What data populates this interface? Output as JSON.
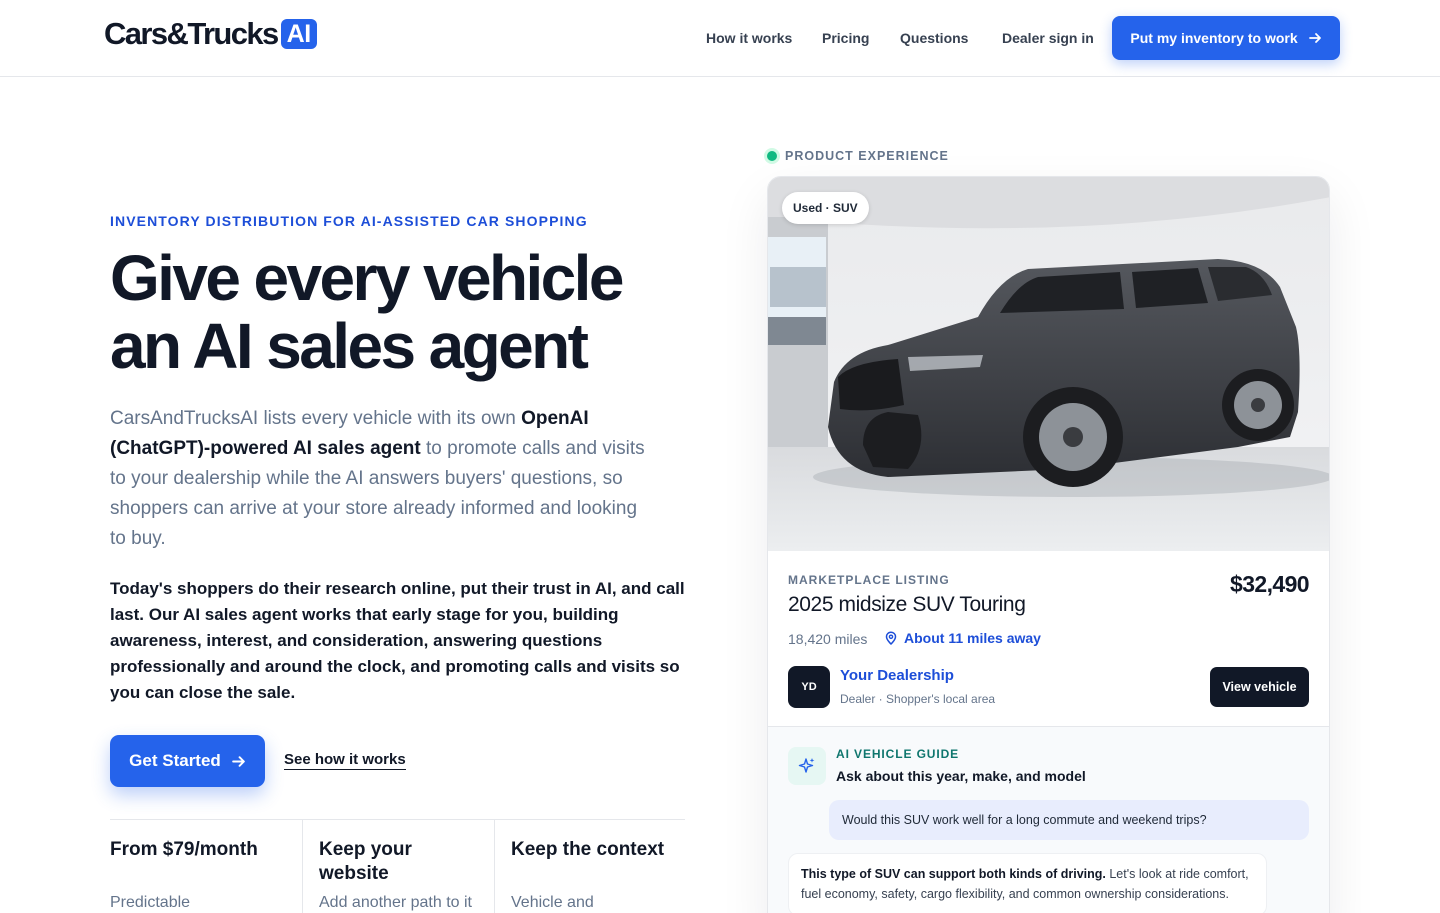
{
  "header": {
    "logo_text": "Cars&Trucks",
    "logo_badge": "AI",
    "nav": [
      "How it works",
      "Pricing",
      "Questions",
      "Dealer sign in"
    ],
    "cta_label": "Put my inventory to work",
    "brand_color": "#2563eb"
  },
  "hero": {
    "eyebrow": "INVENTORY DISTRIBUTION FOR AI-ASSISTED CAR SHOPPING",
    "headline_line1": "Give every vehicle",
    "headline_line2": "an AI sales agent",
    "lead_start": "CarsAndTrucksAI lists every vehicle with its own ",
    "lead_bold": "OpenAI (ChatGPT)-powered AI sales agent",
    "lead_end": " to promote calls and visits to your dealership while the AI answers buyers' questions, so shoppers can arrive at your store already informed and looking to buy.",
    "bold_paragraph": "Today's shoppers do their research online, put their trust in AI, and call last. Our AI sales agent works that early stage for you, building awareness, interest, and consideration, answering questions professionally and around the clock, and promoting calls and visits so you can close the sale.",
    "primary_cta": "Get Started",
    "secondary_cta": "See how it works"
  },
  "features": [
    {
      "title": "From $79/month",
      "desc": "Predictable"
    },
    {
      "title": "Keep your website",
      "desc": "Add another path to it"
    },
    {
      "title": "Keep the context",
      "desc": "Vehicle and"
    }
  ],
  "product": {
    "section_label": "PRODUCT EXPERIENCE",
    "tag": "Used · SUV",
    "listing_label": "MARKETPLACE LISTING",
    "title": "2025 midsize SUV Touring",
    "price": "$32,490",
    "miles": "18,420 miles",
    "distance": "About 11 miles away",
    "dealer_initials": "YD",
    "dealer_name": "Your Dealership",
    "dealer_sub": "Dealer · Shopper's local area",
    "view_button": "View vehicle",
    "guide_label": "AI VEHICLE GUIDE",
    "guide_title": "Ask about this year, make, and model",
    "user_question": "Would this SUV work well for a long commute and weekend trips?",
    "ai_answer_bold": "This type of SUV can support both kinds of driving.",
    "ai_answer_rest": " Let's look at ride comfort, fuel economy, safety, cargo flexibility, and common ownership considerations."
  }
}
